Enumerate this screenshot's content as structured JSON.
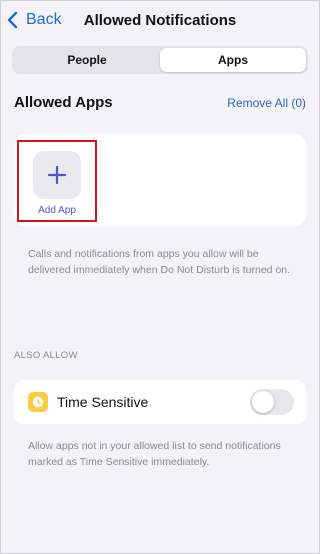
{
  "nav": {
    "back_label": "Back",
    "title": "Allowed Notifications"
  },
  "segmented": {
    "tabs": [
      {
        "label": "People",
        "selected": false
      },
      {
        "label": "Apps",
        "selected": true
      }
    ]
  },
  "allowed_apps": {
    "title": "Allowed Apps",
    "remove_all_label": "Remove All (0)",
    "add_app_label": "Add App",
    "note": "Calls and notifications from apps you allow will be delivered immediately when Do Not Disturb is turned on."
  },
  "also_allow": {
    "header": "ALSO ALLOW",
    "time_sensitive": {
      "label": "Time Sensitive",
      "icon": "clock-icon",
      "enabled": false
    },
    "note": "Allow apps not in your allowed list to send notifications marked as Time Sensitive immediately."
  },
  "colors": {
    "accent_blue": "#1f6bdb",
    "highlight_red": "#d0161c",
    "time_sensitive_yellow": "#f7cd46",
    "background": "#f2f2f7"
  }
}
